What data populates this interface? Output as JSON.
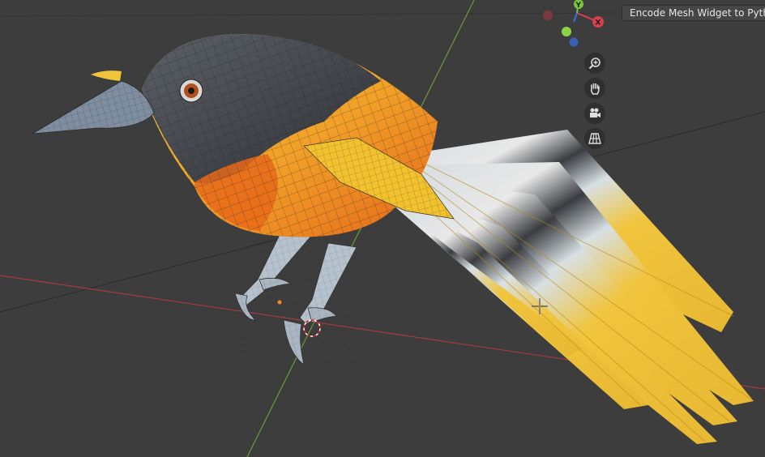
{
  "header": {
    "operator_button_label": "Encode Mesh Widget to Python"
  },
  "gizmo": {
    "x_label": "X",
    "y_label": "Y",
    "x_color": "#d8404c",
    "y_color": "#7ac440",
    "z_color": "#3b6fd4"
  },
  "navigation": {
    "icons": [
      "zoom-icon",
      "hand-pan-icon",
      "camera-icon",
      "grid-perspective-icon"
    ]
  },
  "scene": {
    "background": "#3d3d3d",
    "x_axis_color": "#a43a44",
    "y_axis_color": "#6a9a3a",
    "bird_colors": {
      "head": "#4a4c52",
      "breast": "#e86d1a",
      "belly": "#f2c531",
      "wing": "#efc43a",
      "legs": "#aab8c8"
    }
  }
}
